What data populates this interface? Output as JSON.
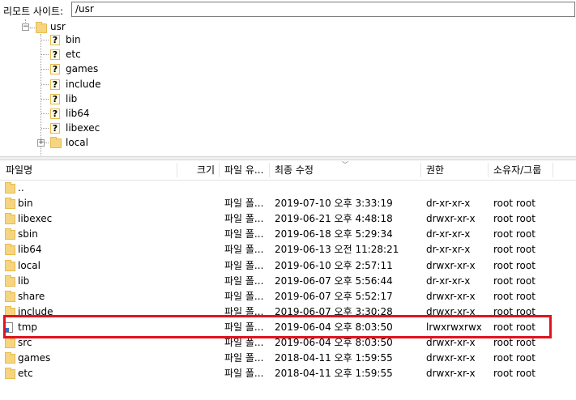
{
  "remote_site": {
    "label": "리모트 사이트:",
    "path": "/usr"
  },
  "tree": {
    "root": {
      "label": "usr"
    },
    "children": [
      {
        "label": "bin",
        "icon": "question-folder-icon"
      },
      {
        "label": "etc",
        "icon": "question-folder-icon"
      },
      {
        "label": "games",
        "icon": "question-folder-icon"
      },
      {
        "label": "include",
        "icon": "question-folder-icon"
      },
      {
        "label": "lib",
        "icon": "question-folder-icon"
      },
      {
        "label": "lib64",
        "icon": "question-folder-icon"
      },
      {
        "label": "libexec",
        "icon": "question-folder-icon"
      },
      {
        "label": "local",
        "icon": "folder-icon"
      }
    ]
  },
  "columns": {
    "name": "파일명",
    "size": "크기",
    "type": "파일 유...",
    "modified": "최종 수정",
    "perms": "권한",
    "owner": "소유자/그룹"
  },
  "files": [
    {
      "name": "..",
      "type": "",
      "modified": "",
      "perms": "",
      "owner": "",
      "icon": "folder-icon"
    },
    {
      "name": "bin",
      "type": "파일 폴...",
      "modified": "2019-07-10 오후 3:33:19",
      "perms": "dr-xr-xr-x",
      "owner": "root root",
      "icon": "folder-icon"
    },
    {
      "name": "libexec",
      "type": "파일 폴...",
      "modified": "2019-06-21 오후 4:48:18",
      "perms": "drwxr-xr-x",
      "owner": "root root",
      "icon": "folder-icon"
    },
    {
      "name": "sbin",
      "type": "파일 폴...",
      "modified": "2019-06-18 오후 5:29:34",
      "perms": "dr-xr-xr-x",
      "owner": "root root",
      "icon": "folder-icon"
    },
    {
      "name": "lib64",
      "type": "파일 폴...",
      "modified": "2019-06-13 오전 11:28:21",
      "perms": "dr-xr-xr-x",
      "owner": "root root",
      "icon": "folder-icon"
    },
    {
      "name": "local",
      "type": "파일 폴...",
      "modified": "2019-06-10 오후 2:57:11",
      "perms": "drwxr-xr-x",
      "owner": "root root",
      "icon": "folder-icon"
    },
    {
      "name": "lib",
      "type": "파일 폴...",
      "modified": "2019-06-07 오후 5:56:44",
      "perms": "dr-xr-xr-x",
      "owner": "root root",
      "icon": "folder-icon"
    },
    {
      "name": "share",
      "type": "파일 폴...",
      "modified": "2019-06-07 오후 5:52:17",
      "perms": "drwxr-xr-x",
      "owner": "root root",
      "icon": "folder-icon"
    },
    {
      "name": "include",
      "type": "파일 폴...",
      "modified": "2019-06-07 오후 3:30:28",
      "perms": "drwxr-xr-x",
      "owner": "root root",
      "icon": "folder-icon"
    },
    {
      "name": "tmp",
      "type": "파일 폴...",
      "modified": "2019-06-04 오후 8:03:50",
      "perms": "lrwxrwxrwx",
      "owner": "root root",
      "icon": "symlink-icon"
    },
    {
      "name": "src",
      "type": "파일 폴...",
      "modified": "2019-06-04 오후 8:03:50",
      "perms": "drwxr-xr-x",
      "owner": "root root",
      "icon": "folder-icon"
    },
    {
      "name": "games",
      "type": "파일 폴...",
      "modified": "2018-04-11 오후 1:59:55",
      "perms": "drwxr-xr-x",
      "owner": "root root",
      "icon": "folder-icon"
    },
    {
      "name": "etc",
      "type": "파일 폴...",
      "modified": "2018-04-11 오후 1:59:55",
      "perms": "drwxr-xr-x",
      "owner": "root root",
      "icon": "folder-icon"
    }
  ],
  "colors": {
    "highlight": "#e0141e",
    "folder": "#f6d580"
  }
}
